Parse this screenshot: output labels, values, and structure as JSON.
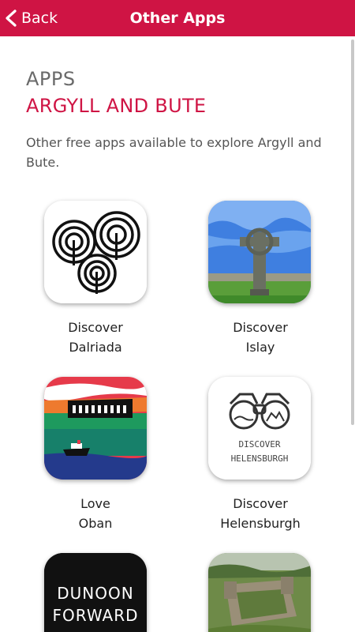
{
  "header": {
    "back_label": "Back",
    "title": "Other Apps",
    "bg_color": "#cf1444"
  },
  "intro": {
    "label": "APPS",
    "title": "ARGYLL AND BUTE",
    "description": "Other free apps available to explore Argyll and Bute."
  },
  "apps": [
    {
      "line1": "Discover",
      "line2": "Dalriada",
      "icon": "dalriada-icon"
    },
    {
      "line1": "Discover",
      "line2": "Islay",
      "icon": "islay-icon"
    },
    {
      "line1": "Love",
      "line2": "Oban",
      "icon": "oban-icon"
    },
    {
      "line1": "Discover",
      "line2": "Helensburgh",
      "icon": "helensburgh-icon",
      "icon_text_1": "DISCOVER",
      "icon_text_2": "HELENSBURGH"
    },
    {
      "line1": "",
      "line2": "",
      "icon": "dunoon-forward-icon",
      "icon_text_1": "DUNOON",
      "icon_text_2": "FORWARD"
    },
    {
      "line1": "",
      "line2": "",
      "icon": "castle-icon"
    }
  ]
}
